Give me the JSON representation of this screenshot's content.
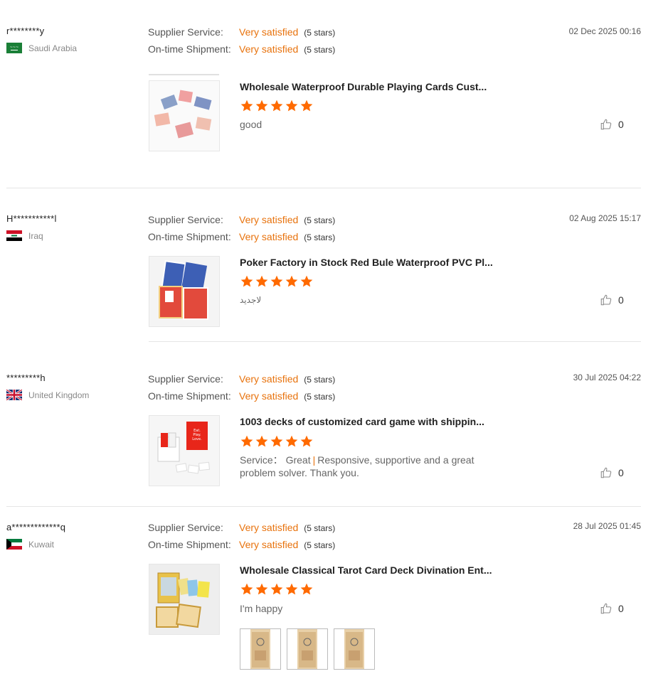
{
  "reviews": [
    {
      "reviewer": "r********y",
      "country": "Saudi Arabia",
      "date": "02 Dec 2025 00:16",
      "supplier_service_label": "Supplier Service:",
      "supplier_service_value": "Very satisfied",
      "supplier_service_stars": "(5 stars)",
      "shipment_label": "On-time Shipment:",
      "shipment_value": "Very satisfied",
      "shipment_stars": "(5 stars)",
      "product_title": "Wholesale Waterproof Durable Playing Cards Cust...",
      "product_rating": 5,
      "comment": "good",
      "likes": "0"
    },
    {
      "reviewer": "H***********l",
      "country": "Iraq",
      "date": "02 Aug 2025 15:17",
      "supplier_service_label": "Supplier Service:",
      "supplier_service_value": "Very satisfied",
      "supplier_service_stars": "(5 stars)",
      "shipment_label": "On-time Shipment:",
      "shipment_value": "Very satisfied",
      "shipment_stars": "(5 stars)",
      "product_title": "Poker Factory in Stock Red Bule Waterproof PVC Pl...",
      "product_rating": 5,
      "comment": "لاجديد",
      "likes": "0"
    },
    {
      "reviewer": "*********h",
      "country": "United Kingdom",
      "date": "30 Jul 2025 04:22",
      "supplier_service_label": "Supplier Service:",
      "supplier_service_value": "Very satisfied",
      "supplier_service_stars": "(5 stars)",
      "shipment_label": "On-time Shipment:",
      "shipment_value": "Very satisfied",
      "shipment_stars": "(5 stars)",
      "product_title": "1003 decks of customized card game with shippin...",
      "product_rating": 5,
      "comment_tag": "Service：  Great",
      "comment_separator": "|",
      "comment": "Responsive, supportive and a great problem solver. Thank you.",
      "likes": "0"
    },
    {
      "reviewer": "a*************q",
      "country": "Kuwait",
      "date": "28 Jul 2025 01:45",
      "supplier_service_label": "Supplier Service:",
      "supplier_service_value": "Very satisfied",
      "supplier_service_stars": "(5 stars)",
      "shipment_label": "On-time Shipment:",
      "shipment_value": "Very satisfied",
      "shipment_stars": "(5 stars)",
      "product_title": "Wholesale Classical Tarot Card Deck Divination Ent...",
      "product_rating": 5,
      "comment": "I'm happy",
      "likes": "0",
      "photo_count": 3
    }
  ],
  "icons": {
    "like": "thumbs-up-icon",
    "star": "star-icon"
  },
  "colors": {
    "accent": "#e8720c",
    "star": "#ff6a00",
    "divider": "#e5e5e5"
  }
}
